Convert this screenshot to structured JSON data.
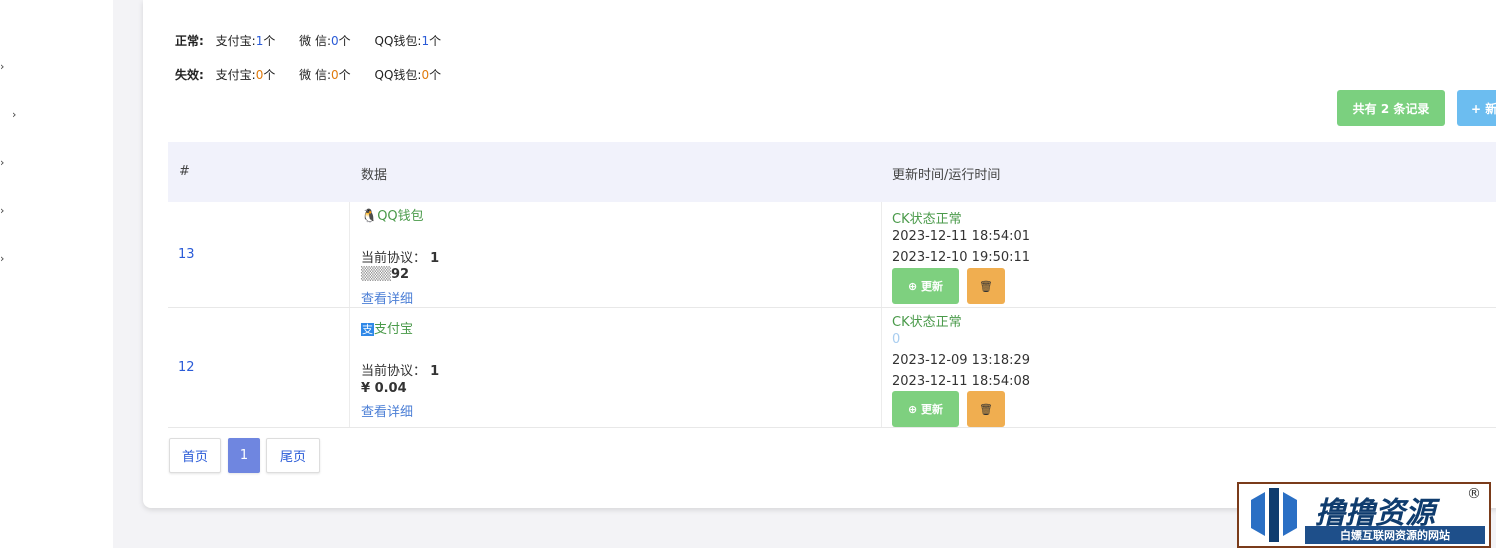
{
  "sidebar": {
    "chevrons": [
      "›",
      "›",
      "›",
      "›",
      "›"
    ]
  },
  "stats": {
    "normal": {
      "label": "正常:",
      "alipay_label": "支付宝:",
      "alipay": "1",
      "wechat_label": "微 信:",
      "wechat": "0",
      "qq_label": "QQ钱包:",
      "qq": "1",
      "unit": "个"
    },
    "invalid": {
      "label": "失效:",
      "alipay_label": "支付宝:",
      "alipay": "0",
      "wechat_label": "微 信:",
      "wechat": "0",
      "qq_label": "QQ钱包:",
      "qq": "0",
      "unit": "个"
    }
  },
  "toolbar": {
    "total_label": "共有 2 条记录",
    "new_label": "+ 新"
  },
  "table": {
    "headers": [
      "#",
      "数据",
      "更新时间/运行时间"
    ],
    "rows": [
      {
        "id": "13",
        "type": "QQ钱包",
        "protocol_label": "当前协议：",
        "protocol": "1",
        "amount": "92",
        "detail": "查看详细",
        "status": "CK状态正常",
        "time1": "2023-12-11 18:54:01",
        "time2": "2023-12-10 19:50:11",
        "update_label": "更新"
      },
      {
        "id": "12",
        "type": "支付宝",
        "protocol_label": "当前协议：",
        "protocol": "1",
        "amount": "¥ 0.04",
        "detail": "查看详细",
        "status": "CK状态正常",
        "extra": "0",
        "time1": "2023-12-09 13:18:29",
        "time2": "2023-12-11 18:54:08",
        "update_label": "更新"
      }
    ]
  },
  "pagination": {
    "first": "首页",
    "current": "1",
    "last": "尾页"
  },
  "watermark": {
    "title": "撸撸资源",
    "subtitle": "白嫖互联网资源的网站",
    "reg": "®"
  }
}
